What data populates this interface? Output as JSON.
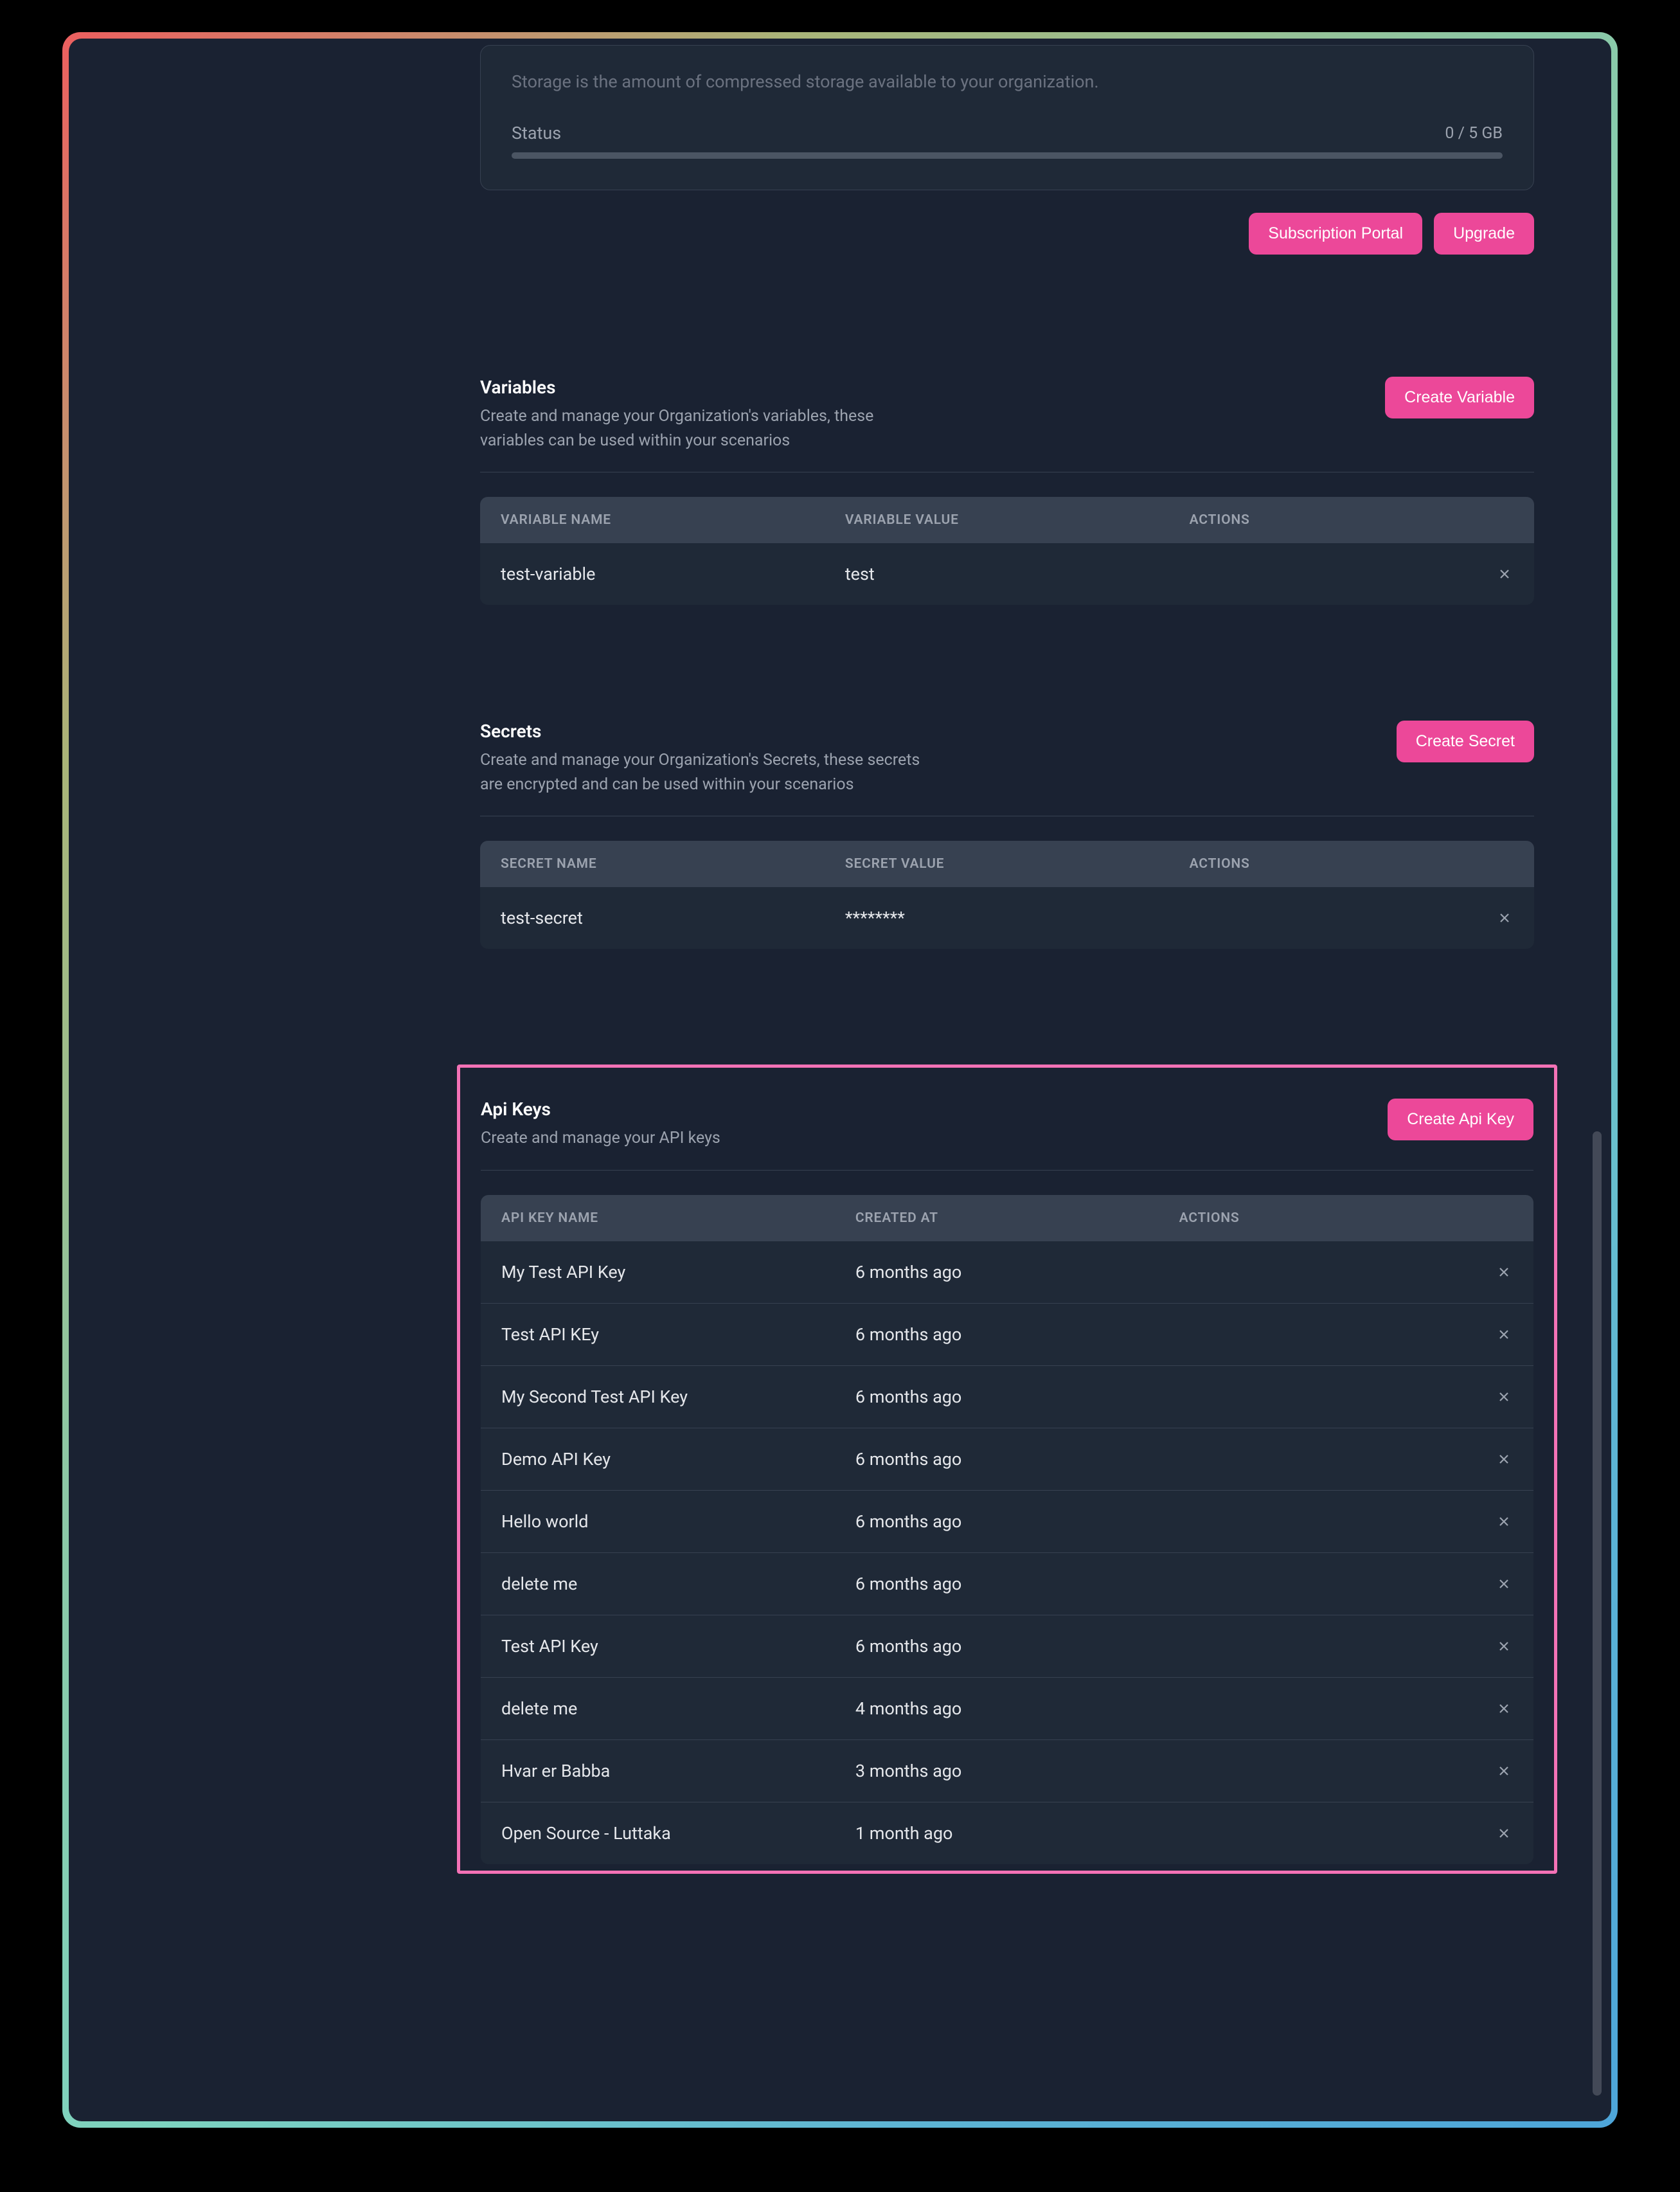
{
  "storage": {
    "description": "Storage is the amount of compressed storage available to your organization.",
    "status_label": "Status",
    "status_value": "0 / 5 GB"
  },
  "buttons": {
    "subscription_portal": "Subscription Portal",
    "upgrade": "Upgrade",
    "create_variable": "Create Variable",
    "create_secret": "Create Secret",
    "create_api_key": "Create Api Key"
  },
  "variables": {
    "title": "Variables",
    "subtitle": "Create and manage your Organization's variables, these variables can be used within your scenarios",
    "columns": {
      "name": "Variable Name",
      "value": "Variable Value",
      "actions": "Actions"
    },
    "rows": [
      {
        "name": "test-variable",
        "value": "test"
      }
    ]
  },
  "secrets": {
    "title": "Secrets",
    "subtitle": "Create and manage your Organization's Secrets, these secrets are encrypted and can be used within your scenarios",
    "columns": {
      "name": "Secret Name",
      "value": "Secret Value",
      "actions": "Actions"
    },
    "rows": [
      {
        "name": "test-secret",
        "value": "********"
      }
    ]
  },
  "api_keys": {
    "title": "Api Keys",
    "subtitle": "Create and manage your API keys",
    "columns": {
      "name": "Api Key Name",
      "created": "Created At",
      "actions": "Actions"
    },
    "rows": [
      {
        "name": "My Test API Key",
        "created": "6 months ago"
      },
      {
        "name": "Test API KEy",
        "created": "6 months ago"
      },
      {
        "name": "My Second Test API Key",
        "created": "6 months ago"
      },
      {
        "name": "Demo API Key",
        "created": "6 months ago"
      },
      {
        "name": "Hello world",
        "created": "6 months ago"
      },
      {
        "name": "delete me",
        "created": "6 months ago"
      },
      {
        "name": "Test API Key",
        "created": "6 months ago"
      },
      {
        "name": "delete me",
        "created": "4 months ago"
      },
      {
        "name": "Hvar er Babba",
        "created": "3 months ago"
      },
      {
        "name": "Open Source - Luttaka",
        "created": "1 month ago"
      }
    ]
  }
}
